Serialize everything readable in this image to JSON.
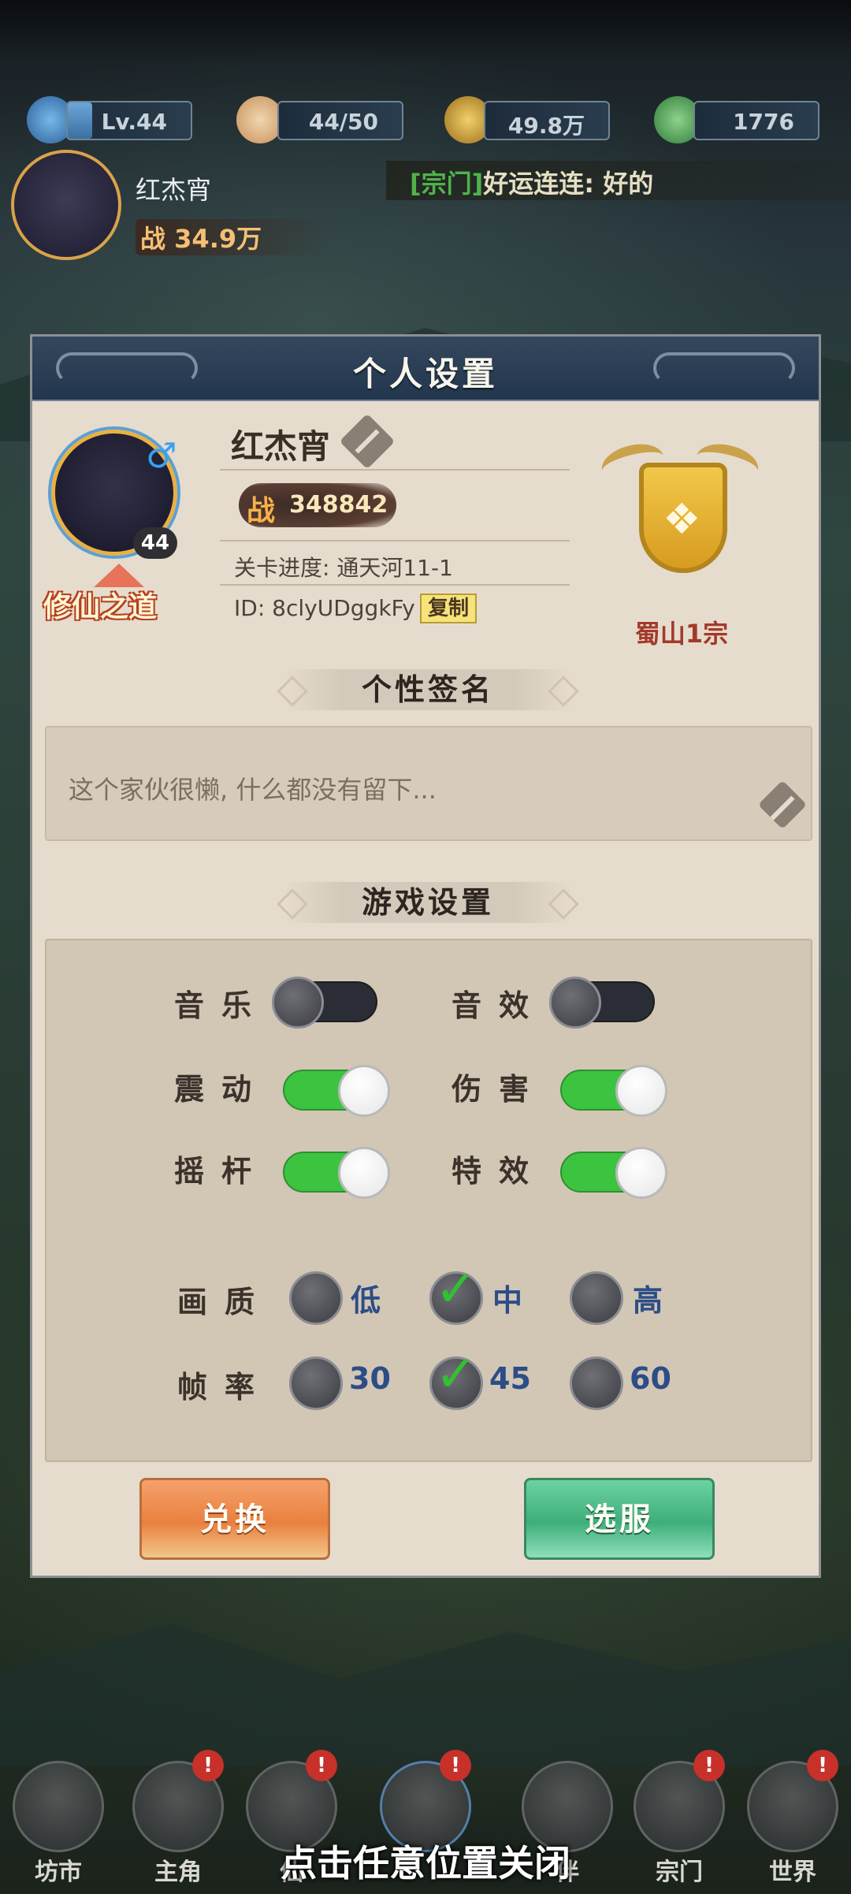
{
  "top_bar": {
    "level": "Lv.44",
    "stamina": "44/50",
    "coins": "49.8万",
    "jade": "1776",
    "player_name": "红杰宵",
    "power_prefix": "战",
    "power": "34.9万",
    "chat_tag": "[宗门]",
    "chat_text": "好运连连: 好的"
  },
  "dialog": {
    "title": "个人设置",
    "profile": {
      "name": "红杰宵",
      "level_badge": "44",
      "power_prefix": "战",
      "power": "348842",
      "progress": "关卡进度: 通天河11-1",
      "id": "ID: 8clyUDggkFy",
      "copy_label": "复制",
      "path_label": "修仙之道",
      "gender_icon": "male-icon"
    },
    "sect_label": "蜀山1宗",
    "signature": {
      "title": "个性签名",
      "text": "这个家伙很懒, 什么都没有留下..."
    },
    "settings": {
      "title": "游戏设置",
      "music_label": "音乐",
      "sfx_label": "音效",
      "vibration_label": "震动",
      "damage_label": "伤害",
      "joystick_label": "摇杆",
      "effects_label": "特效",
      "toggles": {
        "music": false,
        "sfx": false,
        "vibration": true,
        "damage": true,
        "joystick": true,
        "effects": true
      },
      "quality_label": "画质",
      "quality_options": [
        "低",
        "中",
        "高"
      ],
      "quality_selected": "中",
      "framerate_label": "帧率",
      "framerate_options": [
        "30",
        "45",
        "60"
      ],
      "framerate_selected": "45"
    },
    "buttons": {
      "redeem": "兑换",
      "server": "选服"
    }
  },
  "bottom_nav": {
    "items": [
      "坊市",
      "主角",
      "仙",
      "",
      "伴",
      "宗门",
      "世界"
    ],
    "close_hint": "点击任意位置关闭"
  },
  "colors": {
    "toggle_on": "#3cc440",
    "dialog_bg": "#e6dccd",
    "header_bg": "#22364d",
    "option_text": "#2c4d86"
  }
}
